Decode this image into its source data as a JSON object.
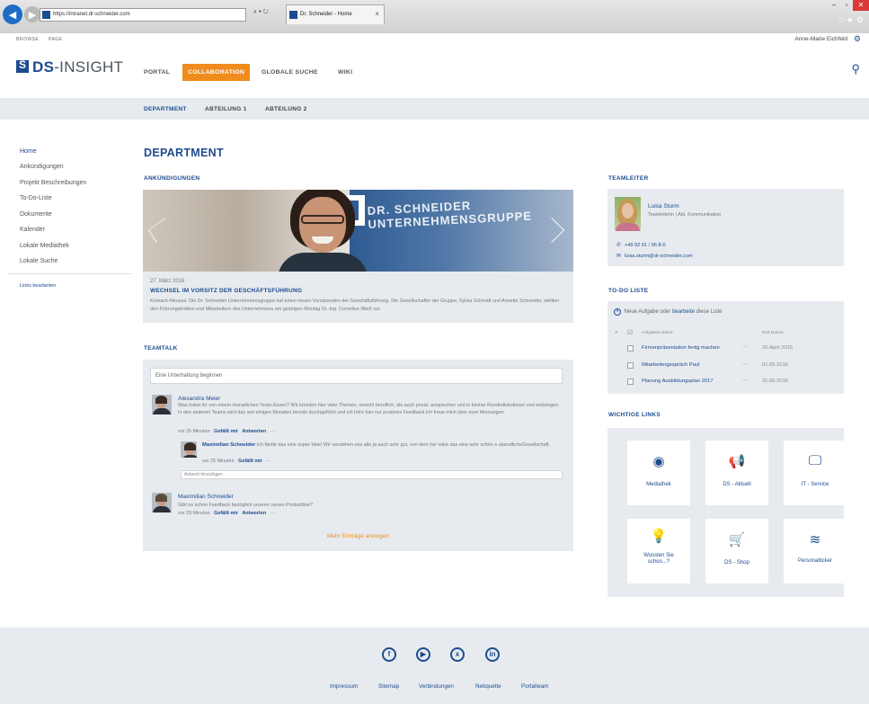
{
  "browser": {
    "url": "https://intranet.dr-schneider.com",
    "addr_controls": "⌕ ▾ ↻",
    "tab_title": "Dr. Schneider - Home",
    "tab_close": "×"
  },
  "ribbon": {
    "browse": "BROWSE",
    "page": "PAGE"
  },
  "user": {
    "name": "Anne-Marie Eichfeld"
  },
  "logo": {
    "prefix": "DS",
    "rest": "-INSIGHT"
  },
  "topnav": [
    {
      "label": "PORTAL"
    },
    {
      "label": "COLLABORATION",
      "active": true
    },
    {
      "label": "GLOBALE SUCHE"
    },
    {
      "label": "WIKI"
    }
  ],
  "subnav": [
    {
      "label": "DEPARTMENT",
      "active": true
    },
    {
      "label": "ABTEILUNG 1"
    },
    {
      "label": "ABTEILUNG 2"
    }
  ],
  "leftnav": [
    {
      "label": "Home",
      "active": true
    },
    {
      "label": "Ankündigungen"
    },
    {
      "label": "Projekt Beschreibungen"
    },
    {
      "label": "To-Do-Liste"
    },
    {
      "label": "Dokumente"
    },
    {
      "label": "Kalender"
    },
    {
      "label": "Lokale Mediathek"
    },
    {
      "label": "Lokale Suche"
    }
  ],
  "links_edit": "Links bearbeiten",
  "page_title": "DEPARTMENT",
  "announcements": {
    "title": "ANKÜNDIGUNGEN",
    "banner_text": "DR. SCHNEIDER UNTERNEHMENSGRUPPE",
    "date": "27. März 2016",
    "headline": "WECHSEL IM VORSITZ DER GESCHÄFTSFÜHRUNG",
    "body": "Kronach-Neuses. Die Dr. Schneider Unternehmensgruppe hat einen neuen Vorsitzenden der Geschäftsführung. Die Gesellschafter der Gruppe, Sylvia Schmidt und Annette Schneider, stellten den Führungskräften und Mitarbeitern des Unternehmens am gestrigen Montag Dr.-Ing. Cornelius Weiß vor."
  },
  "teamtalk": {
    "title": "TEAMTALK",
    "input_placeholder": "Eine Unterhaltung beginnen",
    "posts": [
      {
        "name": "Alexandra Meier",
        "text": "Was haltet ihr von einem monatlichen Team-Essen? Wir könnten hier viele Themen, sowohl beruflich, als auch privat, ansprechen und in kleiner Rundediskutieren und einbringen. In den anderen Teams wird das seit einigen Monaten bereits durchgeführt und ich höre hier nur positives Feedback.Ich freue mich über eure Meinungen.",
        "time": "vor 25 Minuten",
        "like": "Gefällt mir",
        "reply": "Antworten",
        "more": "···"
      },
      {
        "name": "Maximilian Schneider",
        "text": "Ich fände das eine super Idee! Wir verstehen uns alle ja auch sehr gut, von dem her wäre das eine sehr schön e abendlicheGesellschaft.",
        "time": "vor 25 Minuten",
        "like": "Gefällt mir",
        "more": "···"
      },
      {
        "name": "Maximilian Schneider",
        "text": "Gibt es schon Feedback bezüglich unserer neuen Produktline?",
        "time": "vor 29 Minuten",
        "like": "Gefällt mir",
        "reply": "Antworten",
        "more": "···"
      }
    ],
    "reply_placeholder": "Antwort hinzufügen",
    "more_entries": "Mehr Einträge anzeigen"
  },
  "teamleiter": {
    "title": "TEAMLEITER",
    "name": "Luisa Sturm",
    "role": "Teamleiterin | Abt. Kommunikation",
    "phone": "+49 92 61 / 96 8-0",
    "email": "luisa.sturm@dr-schneider.com"
  },
  "todo": {
    "title": "TO-DO LISTE",
    "new_prefix": "Neue Aufgabe oder",
    "new_link": "bearbeite",
    "new_suffix": "diese Liste",
    "col_task": "Aufgaben Name",
    "col_date": "End Datum",
    "items": [
      {
        "name": "Firmenpräsentation fertig machen",
        "date": "25.April 2016"
      },
      {
        "name": "Mitarbeitergespräch Paul",
        "date": "01.05.2016"
      },
      {
        "name": "Planung Ausbildungsplan  2017",
        "date": "31.06.2016"
      }
    ]
  },
  "wichtige_links": {
    "title": "WICHTIGE LINKS",
    "tiles": [
      {
        "label": "Mediathek",
        "icon": "play-icon"
      },
      {
        "label": "DS - Aktuell",
        "icon": "megaphone-icon"
      },
      {
        "label": "IT - Service",
        "icon": "monitor-icon"
      },
      {
        "label": "Wussten Sie schon...?",
        "icon": "lightbulb-person-icon"
      },
      {
        "label": "DS - Shop",
        "icon": "cart-icon"
      },
      {
        "label": "Personalticker",
        "icon": "layers-icon"
      }
    ]
  },
  "footer": {
    "links": [
      "Impressum",
      "Sitemap",
      "Verbindungen",
      "Netiquette",
      "Portalteam"
    ]
  },
  "colors": {
    "brand_blue": "#1d4b8f",
    "accent_orange": "#f08c1e",
    "panel_gray": "#e7ebef"
  }
}
